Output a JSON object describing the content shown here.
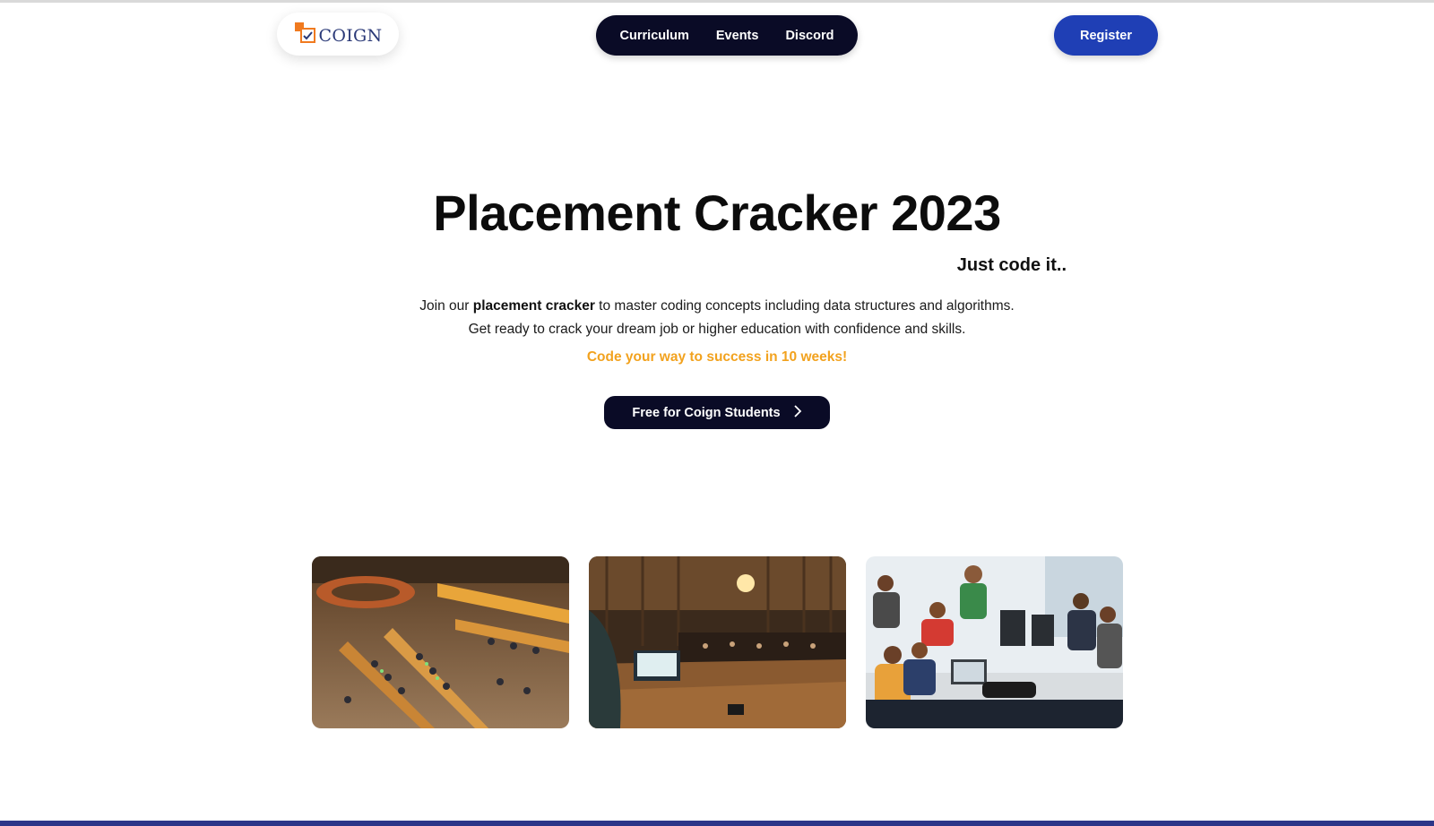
{
  "brand": {
    "logo_text": "COIGN"
  },
  "nav": {
    "links": [
      "Curriculum",
      "Events",
      "Discord"
    ],
    "register_label": "Register"
  },
  "hero": {
    "title": "Placement Cracker 2023",
    "tagline": "Just code it..",
    "desc_line1_pre": "Join our ",
    "desc_line1_bold": "placement cracker",
    "desc_line1_post": " to master coding concepts including data structures and algorithms.",
    "desc_line2": "Get ready to crack your dream job or higher education with confidence and skills.",
    "highlight": "Code your way to success in 10 weeks!",
    "cta_label": "Free for Coign Students"
  },
  "gallery": {
    "photos": [
      "library-reading-room-photo",
      "lecture-hall-laptop-photo",
      "team-coding-photo"
    ]
  },
  "colors": {
    "nav_bg": "#0a0b26",
    "register_bg": "#1f3fb5",
    "highlight": "#f2a21e",
    "logo_orange": "#f07a1f",
    "logo_text": "#2b3a78",
    "footer_band": "#2c3588"
  }
}
